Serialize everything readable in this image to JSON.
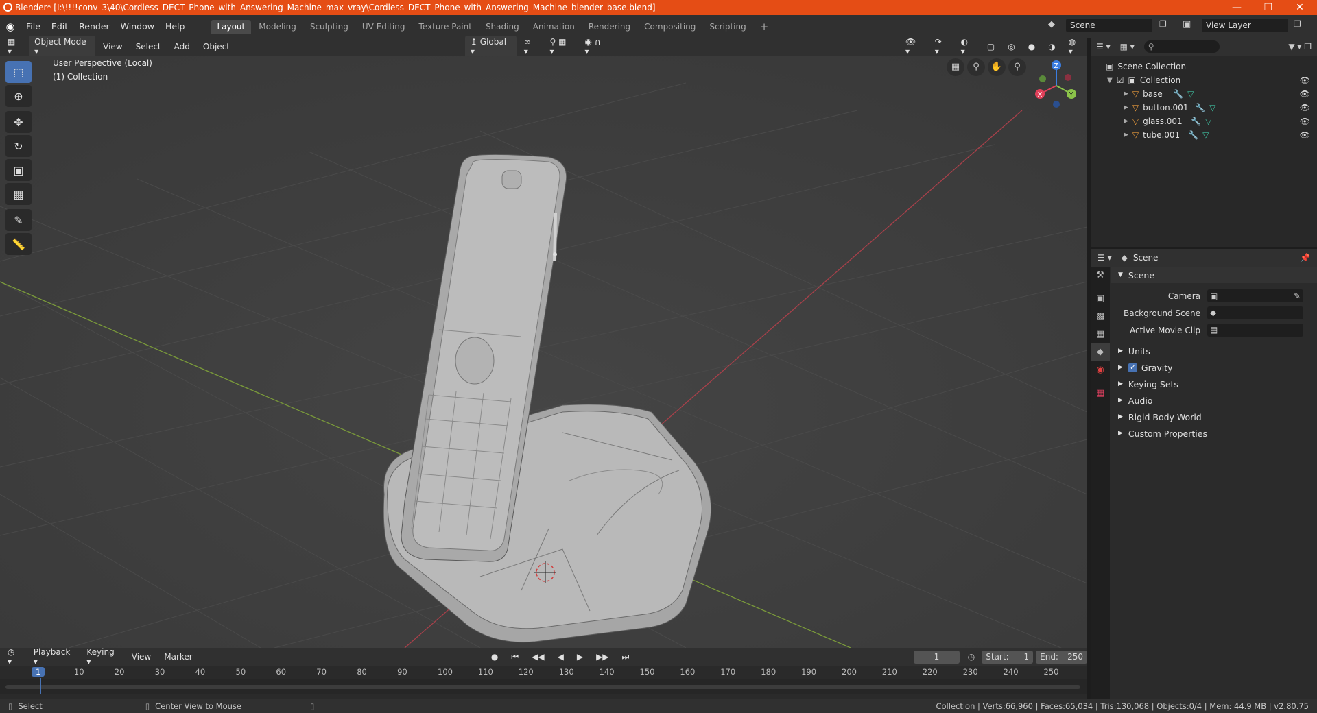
{
  "window": {
    "title": "Blender* [I:\\!!!!conv_3\\40\\Cordless_DECT_Phone_with_Answering_Machine_max_vray\\Cordless_DECT_Phone_with_Answering_Machine_blender_base.blend]"
  },
  "menu": {
    "items": [
      "File",
      "Edit",
      "Render",
      "Window",
      "Help"
    ],
    "workspaces": [
      "Layout",
      "Modeling",
      "Sculpting",
      "UV Editing",
      "Texture Paint",
      "Shading",
      "Animation",
      "Rendering",
      "Compositing",
      "Scripting"
    ],
    "add_label": "+",
    "scene": "Scene",
    "view_layer": "View Layer"
  },
  "viewport_header": {
    "mode": "Object Mode",
    "menus": [
      "View",
      "Select",
      "Add",
      "Object"
    ],
    "orientation": "Global"
  },
  "viewport": {
    "perspective": "User Perspective (Local)",
    "collection": "(1) Collection",
    "gizmo": {
      "x": "X",
      "y": "Y",
      "z": "Z"
    }
  },
  "outliner": {
    "root": "Scene Collection",
    "collection": "Collection",
    "objects": [
      "base",
      "button.001",
      "glass.001",
      "tube.001"
    ]
  },
  "properties": {
    "context": "Scene",
    "section": "Scene",
    "camera_label": "Camera",
    "background_scene_label": "Background Scene",
    "active_movie_clip_label": "Active Movie Clip",
    "panels": [
      "Units",
      "Gravity",
      "Keying Sets",
      "Audio",
      "Rigid Body World",
      "Custom Properties"
    ]
  },
  "timeline": {
    "menus": [
      "Playback",
      "Keying",
      "View",
      "Marker"
    ],
    "current_frame": "1",
    "start_label": "Start:",
    "start": "1",
    "end_label": "End:",
    "end": "250",
    "ruler": [
      "1",
      "10",
      "20",
      "30",
      "40",
      "50",
      "60",
      "70",
      "80",
      "90",
      "100",
      "110",
      "120",
      "130",
      "140",
      "150",
      "160",
      "170",
      "180",
      "190",
      "200",
      "210",
      "220",
      "230",
      "240",
      "250"
    ]
  },
  "statusbar": {
    "select": "Select",
    "center_view": "Center View to Mouse",
    "stats": "Collection | Verts:66,960 | Faces:65,034 | Tris:130,068 | Objects:0/4 | Mem: 44.9 MB | v2.80.75"
  },
  "colors": {
    "titlebar": "#e54d15",
    "accent": "#4772b3",
    "object_icon": "#e89a3c",
    "mesh_icon": "#3fbfa0",
    "axis_x": "#e0405a",
    "axis_y": "#8bc34a",
    "axis_z": "#3b7de0"
  }
}
